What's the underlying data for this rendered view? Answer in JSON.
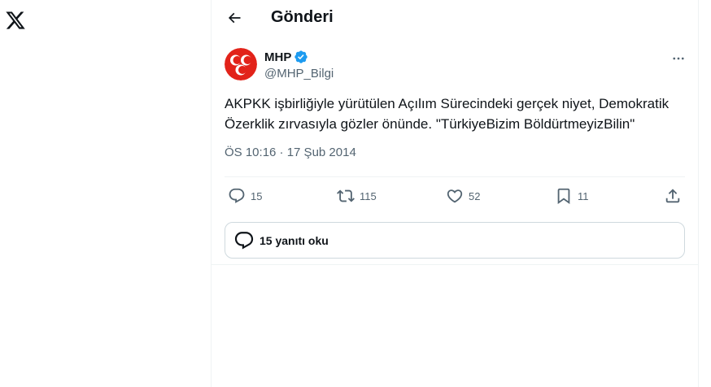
{
  "header": {
    "title": "Gönderi"
  },
  "tweet": {
    "display_name": "MHP",
    "handle": "@MHP_Bilgi",
    "text": "AKPKK işbirliğiyle yürütülen Açılım Sürecindeki gerçek niyet, Demokratik Özerklik zırvasıyla gözler önünde. \"TürkiyeBizim BöldürtmeyizBilin\"",
    "timestamp": "ÖS 10:16 · 17 Şub 2014"
  },
  "actions": {
    "replies": "15",
    "reposts": "115",
    "likes": "52",
    "bookmarks": "11"
  },
  "replies_link": {
    "label": "15 yanıtı oku"
  },
  "icons": {
    "logo": "x-logo-icon",
    "back": "back-arrow-icon",
    "verified": "verified-badge-icon",
    "more": "more-dots-icon",
    "reply": "reply-icon",
    "repost": "repost-icon",
    "like": "heart-icon",
    "bookmark": "bookmark-icon",
    "share": "share-icon",
    "replies_bubble": "chat-bubble-icon"
  },
  "colors": {
    "text_primary": "#0f1419",
    "text_secondary": "#536471",
    "verified_blue": "#1d9bf0",
    "brand_red": "#e2231a",
    "border": "#eff3f4"
  }
}
